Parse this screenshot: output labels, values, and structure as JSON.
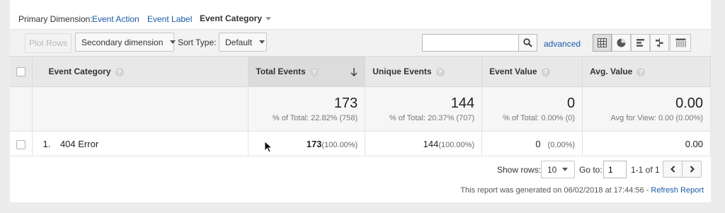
{
  "primary_dimension": {
    "label": "Primary Dimension:",
    "options": [
      {
        "label": "Event Action",
        "active": false
      },
      {
        "label": "Event Label",
        "active": false
      },
      {
        "label": "Event Category",
        "active": true
      }
    ]
  },
  "toolbar": {
    "plot_rows": "Plot Rows",
    "secondary_dimension": "Secondary dimension",
    "sort_type_label": "Sort Type:",
    "sort_type_value": "Default",
    "search_value": "",
    "advanced": "advanced",
    "view_icons": [
      "table-view-icon",
      "pie-chart-icon",
      "performance-icon",
      "comparison-icon",
      "pivot-icon"
    ]
  },
  "table": {
    "columns": [
      "Event Category",
      "Total Events",
      "Unique Events",
      "Event Value",
      "Avg. Value"
    ],
    "sorted_column": "Total Events",
    "totals": {
      "total_events": {
        "value": "173",
        "sub": "% of Total: 22.82% (758)"
      },
      "unique_events": {
        "value": "144",
        "sub": "% of Total: 20.37% (707)"
      },
      "event_value": {
        "value": "0",
        "sub": "% of Total: 0.00% (0)"
      },
      "avg_value": {
        "value": "0.00",
        "sub": "Avg for View: 0.00 (0.00%)"
      }
    },
    "rows": [
      {
        "index": "1.",
        "category": "404 Error",
        "total_events": "173",
        "total_events_pct": "(100.00%)",
        "unique_events": "144",
        "unique_events_pct": "(100.00%)",
        "event_value": "0",
        "event_value_pct": "(0.00%)",
        "avg_value": "0.00"
      }
    ]
  },
  "pagination": {
    "show_rows_label": "Show rows:",
    "show_rows_value": "10",
    "go_to_label": "Go to:",
    "go_to_value": "1",
    "range": "1-1 of 1"
  },
  "footer": {
    "generated": "This report was generated on 06/02/2018 at 17:44:56 - ",
    "refresh": "Refresh Report"
  },
  "colors": {
    "link": "#1a5aa8",
    "header_bg": "#e8e8e8",
    "totals_bg": "#f6f6f6"
  }
}
